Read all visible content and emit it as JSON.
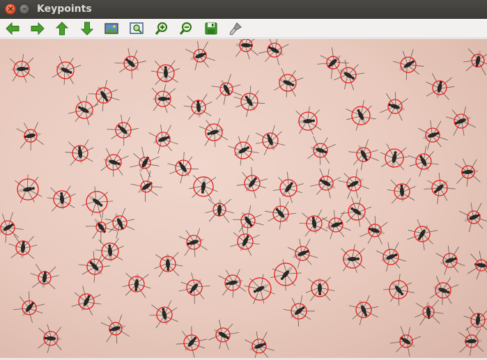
{
  "window": {
    "title": "Keypoints",
    "close_glyph": "×",
    "minimize_glyph": "–"
  },
  "toolbar": {
    "buttons": [
      {
        "name": "pan-left-button",
        "icon": "arrow-left-icon"
      },
      {
        "name": "pan-right-button",
        "icon": "arrow-right-icon"
      },
      {
        "name": "pan-up-button",
        "icon": "arrow-up-icon"
      },
      {
        "name": "pan-down-button",
        "icon": "arrow-down-icon"
      },
      {
        "name": "zoom-image-button",
        "icon": "image-icon"
      },
      {
        "name": "zoom-fit-button",
        "icon": "zoom-region-icon"
      },
      {
        "name": "zoom-in-button",
        "icon": "zoom-in-icon"
      },
      {
        "name": "zoom-out-button",
        "icon": "zoom-out-icon"
      },
      {
        "name": "save-button",
        "icon": "floppy-disk-icon"
      },
      {
        "name": "properties-button",
        "icon": "brush-icon"
      }
    ]
  },
  "image": {
    "description": "mosquito-swarm-keypoints",
    "background_color": "#ebcdc2",
    "keypoint_color": "#e51c1c"
  }
}
